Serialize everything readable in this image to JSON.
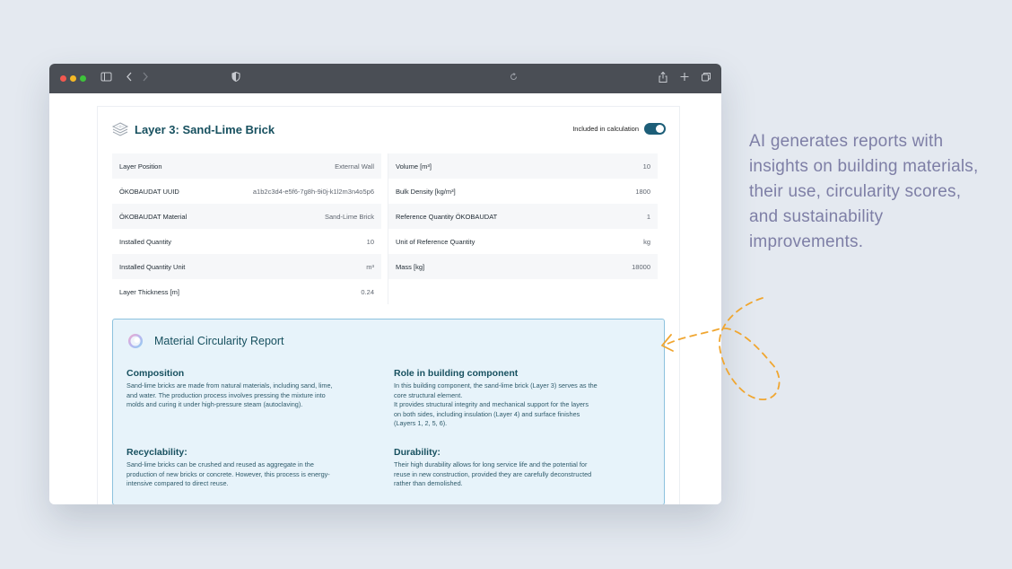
{
  "layer": {
    "title": "Layer 3: Sand-Lime Brick",
    "toggle_label": "Included in calculation",
    "included": true
  },
  "properties_left": [
    {
      "label": "Layer Position",
      "value": "External Wall"
    },
    {
      "label": "ÖKOBAUDAT UUID",
      "value": "a1b2c3d4-e5f6-7g8h-9i0j-k1l2m3n4o5p6"
    },
    {
      "label": "ÖKOBAUDAT Material",
      "value": "Sand-Lime Brick"
    },
    {
      "label": "Installed Quantity",
      "value": "10"
    },
    {
      "label": "Installed Quantity Unit",
      "value": "m³"
    },
    {
      "label": "Layer Thickness [m]",
      "value": "0.24"
    }
  ],
  "properties_right": [
    {
      "label": "Volume [m³]",
      "value": "10"
    },
    {
      "label": "Bulk Density [kg/m³]",
      "value": "1800"
    },
    {
      "label": "Reference Quantity ÖKOBAUDAT",
      "value": "1"
    },
    {
      "label": "Unit of Reference Quantity",
      "value": "kg"
    },
    {
      "label": "Mass [kg]",
      "value": "18000"
    }
  ],
  "report": {
    "title": "Material Circularity Report",
    "composition": {
      "heading": "Composition",
      "text": "Sand-lime bricks are made from natural materials, including sand, lime,\nand water. The production process involves pressing the mixture into\nmolds and curing it under high-pressure steam (autoclaving)."
    },
    "role": {
      "heading": "Role in building component",
      "text": "In this building component, the sand-lime brick (Layer 3) serves as the\ncore structural element.\nIt provides structural integrity and mechanical support for the layers\non both sides, including insulation (Layer 4) and surface finishes\n(Layers 1, 2, 5, 6)."
    },
    "recyclability": {
      "heading": "Recyclability:",
      "text": "Sand-lime bricks can be crushed and reused as aggregate in the\nproduction of new bricks or concrete. However, this process is energy-\nintensive compared to direct reuse."
    },
    "durability": {
      "heading": "Durability:",
      "text": "Their high durability allows for long service life and the potential for\nreuse in new construction, provided they are carefully deconstructed\nrather than demolished."
    }
  },
  "tagline": "AI generates reports with insights on building materials, their use, circularity scores, and sustainability improvements.",
  "colors": {
    "accent": "#17505f",
    "toggle": "#1d5e78",
    "report_bg": "#e7f3fa",
    "report_border": "#8cc2de",
    "tagline": "#7e7fa6",
    "arrow": "#f0a630"
  }
}
